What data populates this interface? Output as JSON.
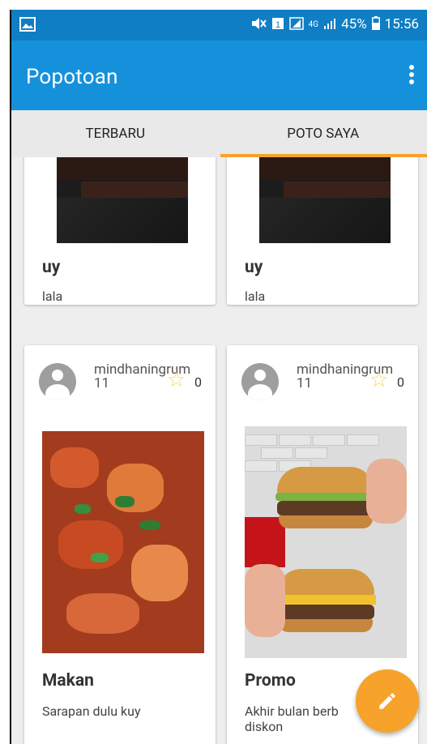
{
  "status_bar": {
    "battery": "45%",
    "time": "15:56",
    "network": "4G",
    "icons": [
      "gallery-icon",
      "mute-icon",
      "sim-icon",
      "signal-icon",
      "battery-icon"
    ]
  },
  "app_bar": {
    "title": "Popotoan",
    "overflow_icon": "overflow-menu-icon"
  },
  "tabs": [
    {
      "label": "TERBARU",
      "selected": false
    },
    {
      "label": "POTO SAYA",
      "selected": true
    }
  ],
  "colors": {
    "status_bar": "#0f7ec4",
    "app_bar": "#1591db",
    "accent": "#f6a22b",
    "star": "#f7d94c"
  },
  "posts": [
    {
      "title": "uy",
      "description": "lala"
    },
    {
      "title": "uy",
      "description": "lala"
    },
    {
      "username": "mindhaningrum",
      "username_line2": "11",
      "likes": "0",
      "title": "Makan",
      "description": "Sarapan dulu kuy"
    },
    {
      "username": "mindhaningrum",
      "username_line2": "11",
      "likes": "0",
      "title": "Promo",
      "description": "Akhir bulan berb",
      "description_line2": "diskon"
    }
  ],
  "fab": {
    "icon": "edit-icon"
  }
}
